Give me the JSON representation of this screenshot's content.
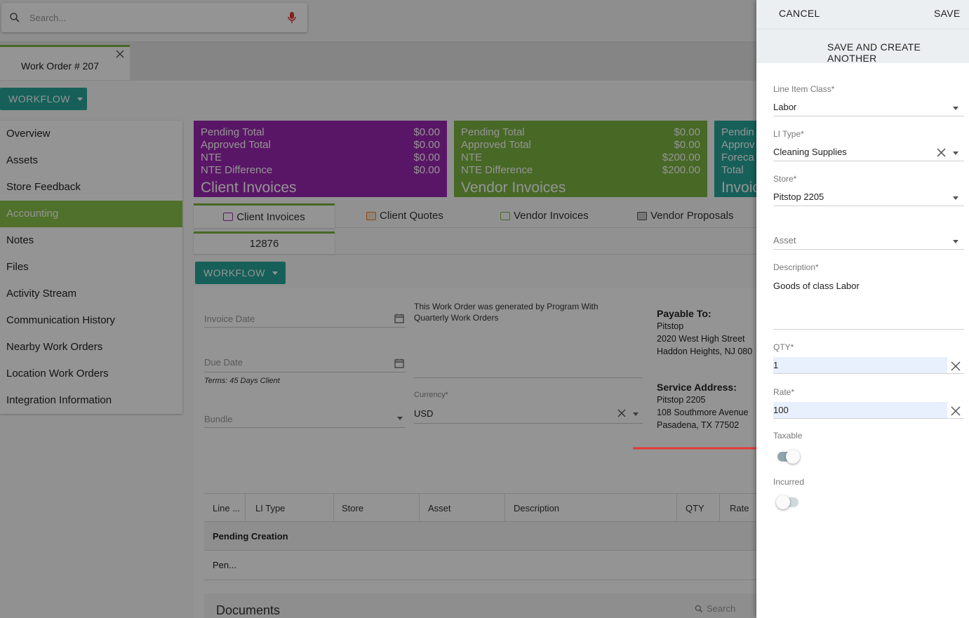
{
  "search": {
    "placeholder": "Search..."
  },
  "work_order_tab": {
    "label": "Work Order # 207"
  },
  "workflow_button": {
    "label": "WORKFLOW"
  },
  "sidenav": {
    "items": [
      {
        "label": "Overview"
      },
      {
        "label": "Assets"
      },
      {
        "label": "Store Feedback"
      },
      {
        "label": "Accounting"
      },
      {
        "label": "Notes"
      },
      {
        "label": "Files"
      },
      {
        "label": "Activity Stream"
      },
      {
        "label": "Communication History"
      },
      {
        "label": "Nearby Work Orders"
      },
      {
        "label": "Location Work Orders"
      },
      {
        "label": "Integration Information"
      }
    ],
    "active": "Accounting"
  },
  "cards": {
    "client": {
      "rows": [
        {
          "label": "Pending Total",
          "value": "$0.00"
        },
        {
          "label": "Approved Total",
          "value": "$0.00"
        },
        {
          "label": "NTE",
          "value": "$0.00"
        },
        {
          "label": "NTE Difference",
          "value": "$0.00"
        }
      ],
      "title": "Client Invoices",
      "color": "#9c27b0"
    },
    "vendor": {
      "rows": [
        {
          "label": "Pending Total",
          "value": "$0.00"
        },
        {
          "label": "Approved Total",
          "value": "$0.00"
        },
        {
          "label": "NTE",
          "value": "$200.00"
        },
        {
          "label": "NTE Difference",
          "value": "$200.00"
        }
      ],
      "title": "Vendor Invoices",
      "color": "#7cb342"
    },
    "third": {
      "rows": [
        "Pendin",
        "Approv",
        "Foreca",
        "Total"
      ],
      "title": "Invoic",
      "color": "#26a69a"
    }
  },
  "subtabs": [
    "Client Invoices",
    "Client Quotes",
    "Vendor Invoices",
    "Vendor Proposals"
  ],
  "invoice_tab": "12876",
  "invoice_form": {
    "invoice_date_label": "Invoice Date",
    "due_date_label": "Due Date",
    "terms": "Terms: 45 Days Client",
    "bundle_label": "Bundle",
    "note": "This Work Order was generated by Program With Quarterly Work Orders",
    "currency_label": "Currency*",
    "currency_value": "USD",
    "payable_heading": "Payable To:",
    "payable_lines": [
      "Pitstop",
      "2020 West High Street",
      "Haddon Heights, NJ 080"
    ],
    "service_heading": "Service Address:",
    "service_lines": [
      "Pitstop 2205",
      "108 Southmore Avenue",
      "Pasadena, TX 77502"
    ]
  },
  "table": {
    "columns": [
      "Line ...",
      "LI Type",
      "Store",
      "Asset",
      "Description",
      "QTY",
      "Rate"
    ],
    "group": "Pending Creation",
    "row_first_cell": "Pen..."
  },
  "documents": {
    "title": "Documents",
    "search": "Search"
  },
  "panel": {
    "cancel": "CANCEL",
    "save": "SAVE",
    "save_create": "SAVE AND CREATE ANOTHER",
    "line_item_class": {
      "label": "Line Item Class*",
      "value": "Labor"
    },
    "li_type": {
      "label": "LI Type*",
      "value": "Cleaning Supplies"
    },
    "store": {
      "label": "Store*",
      "value": "Pitstop 2205"
    },
    "asset": {
      "label": "Asset",
      "value": ""
    },
    "description": {
      "label": "Description*",
      "value": "Goods of class Labor"
    },
    "qty": {
      "label": "QTY*",
      "value": "1"
    },
    "rate": {
      "label": "Rate*",
      "value": "100"
    },
    "taxable": {
      "label": "Taxable",
      "on": true
    },
    "incurred": {
      "label": "Incurred",
      "on": false
    }
  },
  "colors": {
    "accent_green": "#7cb342",
    "teal": "#26a69a",
    "purple": "#9c27b0",
    "arrow": "#e53935"
  }
}
